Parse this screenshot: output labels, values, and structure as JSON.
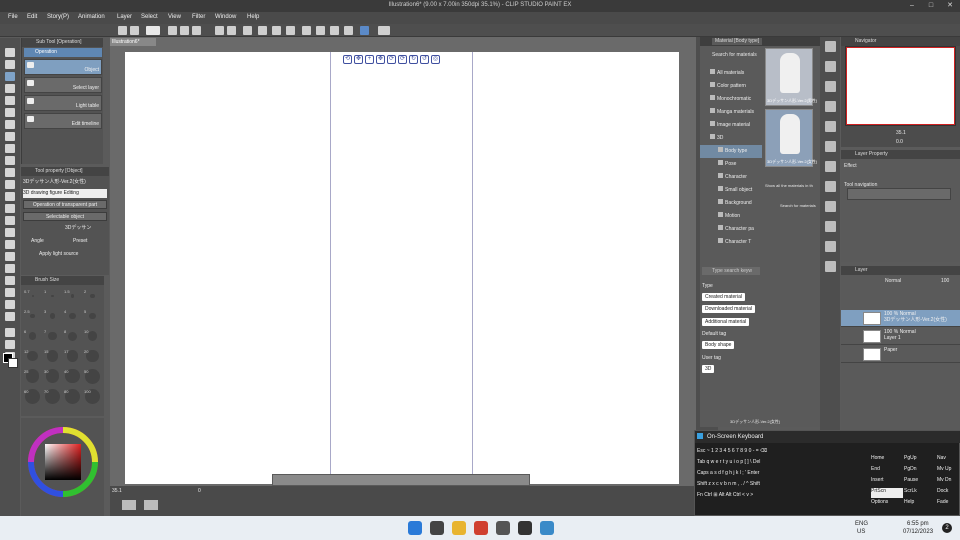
{
  "title": "Illustration6* (9.00 x 7.00in 350dpi 35.1%)  - CLIP STUDIO PAINT EX",
  "menu": [
    "File",
    "Edit",
    "Story(P)",
    "Animation",
    "Layer",
    "Select",
    "View",
    "Filter",
    "Window",
    "Help"
  ],
  "doc_tab": "Illustration6*",
  "subtool": {
    "tab": "Sub Tool [Operation]",
    "group": "Operation",
    "items": [
      "Object",
      "Select layer",
      "Light table",
      "Edit timeline"
    ]
  },
  "toolprop": {
    "tab": "Tool property [Object]",
    "object": "3Dデッサン人形-Ver.2(女性)",
    "sub": "3D drawing figure Editing",
    "transparent": "Operation of transparent part",
    "selectable": "Selectable object",
    "model": "3Dデッサン",
    "angle": "Angle",
    "preset": "Preset",
    "light": "Apply light source"
  },
  "brushsize": {
    "tab": "Brush Size",
    "labels": [
      "0.7",
      "1",
      "1.5",
      "2",
      "2.5",
      "3",
      "4",
      "5",
      "6",
      "7",
      "8",
      "10",
      "12",
      "15",
      "17",
      "20",
      "25",
      "30",
      "40",
      "50",
      "60",
      "70",
      "80",
      "100"
    ]
  },
  "material": {
    "tabs": [
      "Material [Body type]"
    ],
    "search": "Search for materials",
    "tree": [
      "All materials",
      "Color pattern",
      "Monochromatic",
      "Manga materials",
      "Image material",
      "3D",
      "Body type",
      "Pose",
      "Character",
      "Small object",
      "Background",
      "Motion",
      "Character pa",
      "Character T"
    ],
    "selected_tree_index": 6,
    "thumbs": [
      "3Dデッサン人形-Ver.2(男性)",
      "3Dデッサン人形-Ver.2(女性)"
    ],
    "show_all": "Show all the materials in th",
    "search2": "Search for materials",
    "keyword_placeholder": "Type search keyw",
    "type_label": "Type",
    "type_tags": [
      "Created material",
      "Downloaded material",
      "Additional material"
    ],
    "default_tag_label": "Default tag",
    "default_tags": [
      "Body shape"
    ],
    "user_tag_label": "User tag",
    "user_tags": [
      "3D"
    ],
    "bottom_item": "3Dデッサン人形-Ver.2(女性)"
  },
  "navigator": {
    "tab": "Navigator",
    "zoom": "35.1",
    "angle": "0.0"
  },
  "layerprop": {
    "tab": "Layer Property",
    "effect": "Effect",
    "nav": "Tool navigation"
  },
  "layers": {
    "tab": "Layer",
    "blend": "Normal",
    "opacity": "100",
    "items": [
      {
        "line1": "100 % Normal",
        "line2": "3Dデッサン人形-Ver.2(女性)"
      },
      {
        "line1": "100 % Normal",
        "line2": "Layer 1"
      },
      {
        "line1": "",
        "line2": "Paper"
      }
    ]
  },
  "osk": {
    "title": "On-Screen Keyboard",
    "rows": [
      "Esc  ~  1  2  3  4  5  6  7  8  9  0  -  =  ⌫",
      "Tab  q  w  e  r  t  y  u  i  o  p  [  ]  \\  Del",
      "Caps  a  s  d  f  g  h  j  k  l  ;  '  Enter",
      "Shift  z  x  c  v  b  n  m  ,  .  /  ^  Shift",
      "Fn  Ctrl  ⊞  Alt                     Alt  Ctrl  <  v  >"
    ],
    "fkeys": [
      [
        "Home",
        "PgUp",
        "Nav"
      ],
      [
        "End",
        "PgDn",
        "Mv Up"
      ],
      [
        "Insert",
        "Pause",
        "Mv Dn"
      ],
      [
        "PrtScn",
        "ScrLk",
        "Dock"
      ],
      [
        "Options",
        "Help",
        "Fade"
      ]
    ]
  },
  "statusbar": {
    "zoom": "35.1",
    "angle": "0"
  },
  "taskbar": {
    "lang1": "ENG",
    "lang2": "US",
    "time": "6:55 pm",
    "date": "07/12/2023",
    "badge": "2"
  }
}
